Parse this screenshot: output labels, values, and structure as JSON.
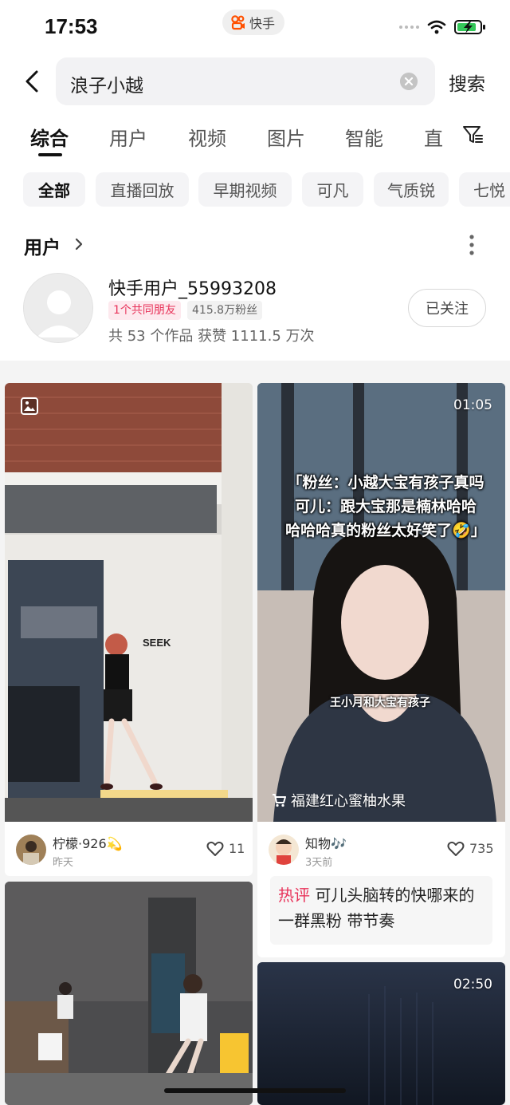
{
  "status_bar": {
    "time": "17:53",
    "app_name": "快手",
    "battery_icon": "battery-charging-icon",
    "wifi_icon": "wifi-icon"
  },
  "search": {
    "query": "浪子小越",
    "submit_label": "搜索",
    "back_icon": "back-arrow-icon",
    "clear_icon": "clear-circle-icon"
  },
  "tabs": [
    {
      "label": "综合",
      "active": true
    },
    {
      "label": "用户"
    },
    {
      "label": "视频"
    },
    {
      "label": "图片"
    },
    {
      "label": "智能"
    },
    {
      "label": "直"
    }
  ],
  "filter_icon": "filter-icon",
  "chips": [
    {
      "label": "全部",
      "active": true
    },
    {
      "label": "直播回放"
    },
    {
      "label": "早期视频"
    },
    {
      "label": "可凡"
    },
    {
      "label": "气质锐"
    },
    {
      "label": "七悦"
    }
  ],
  "user_section": {
    "title": "用户",
    "user": {
      "name": "快手用户_55993208",
      "mutual_tag": "1个共同朋友",
      "fans_tag": "415.8万粉丝",
      "stats": "共 53 个作品  获赞 1111.5 万次",
      "follow_label": "已关注"
    }
  },
  "feed": {
    "left": [
      {
        "type": "photo",
        "sign_text": "SEEK",
        "author": "柠檬·926💫",
        "time": "昨天",
        "likes": "11"
      },
      {
        "type": "photo"
      }
    ],
    "right": [
      {
        "type": "video",
        "duration": "01:05",
        "caption_lines": [
          "「粉丝：小越大宝有孩子真吗",
          "可儿：跟大宝那是楠林哈哈",
          "哈哈哈真的粉丝太好笑了🤣」"
        ],
        "sub_caption": "王小月和大宝有孩子",
        "shop_text": "福建红心蜜柚水果",
        "author": "知物🎶",
        "time": "3天前",
        "likes": "735",
        "hot_label": "热评",
        "hot_text": "可儿头脑转的快哪来的一群黑粉 带节奏"
      },
      {
        "type": "video",
        "duration": "02:50"
      }
    ]
  },
  "colors": {
    "accent_pink": "#e8335a",
    "page_bg": "#ffffff",
    "feed_bg": "#f4f4f4"
  }
}
